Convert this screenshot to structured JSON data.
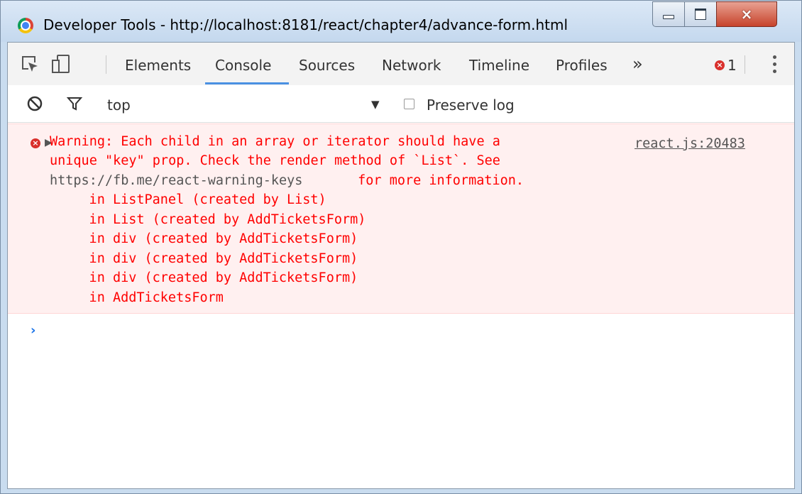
{
  "window": {
    "title": "Developer Tools - http://localhost:8181/react/chapter4/advance-form.html",
    "controls": {
      "minimize": "minimize",
      "maximize": "maximize",
      "close": "×"
    }
  },
  "toolbar": {
    "tabs": [
      {
        "label": "Elements"
      },
      {
        "label": "Console",
        "active": true
      },
      {
        "label": "Sources"
      },
      {
        "label": "Network"
      },
      {
        "label": "Timeline"
      },
      {
        "label": "Profiles"
      }
    ],
    "overflow": "»",
    "error_badge_glyph": "×",
    "error_count": "1"
  },
  "filter": {
    "context": "top",
    "dropdown": "▼",
    "preserve_log": {
      "label": "Preserve log",
      "checked": false
    }
  },
  "console": {
    "message": {
      "level": "error",
      "icon_glyph": "×",
      "expand_glyph": "▶",
      "lines": [
        "Warning: Each child in an array or iterator should have a",
        "unique \"key\" prop. Check the render method of `List`. See",
        "https://fb.me/react-warning-keys",
        " for more information.",
        "    in ListPanel (created by List)",
        "    in List (created by AddTicketsForm)",
        "    in div (created by AddTicketsForm)",
        "    in div (created by AddTicketsForm)",
        "    in div (created by AddTicketsForm)",
        "    in AddTicketsForm"
      ],
      "source": "react.js:20483"
    },
    "prompt": "›"
  },
  "colors": {
    "error_text": "#ff0000",
    "error_bg": "#fff0f0",
    "active_tab": "#4a90e2",
    "title_bar": "#c9dcef"
  }
}
